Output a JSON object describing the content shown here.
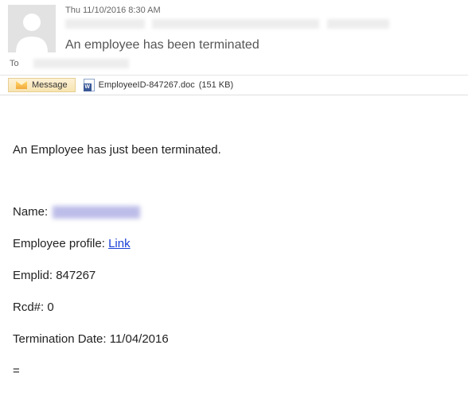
{
  "header": {
    "date": "Thu 11/10/2016 8:30 AM",
    "subject": "An employee has been terminated",
    "to_label": "To"
  },
  "tabs": {
    "message_label": "Message"
  },
  "attachment": {
    "name": "EmployeeID-847267.doc",
    "size": "(151 KB)"
  },
  "body": {
    "intro": "An Employee has just been terminated.",
    "name_label": "Name:",
    "profile_label": "Employee profile:",
    "profile_link": "Link",
    "emplid_label": "Emplid:",
    "emplid_value": "847267",
    "rcd_label": "Rcd#:",
    "rcd_value": "0",
    "termdate_label": "Termination Date:",
    "termdate_value": "11/04/2016",
    "tail": "="
  }
}
